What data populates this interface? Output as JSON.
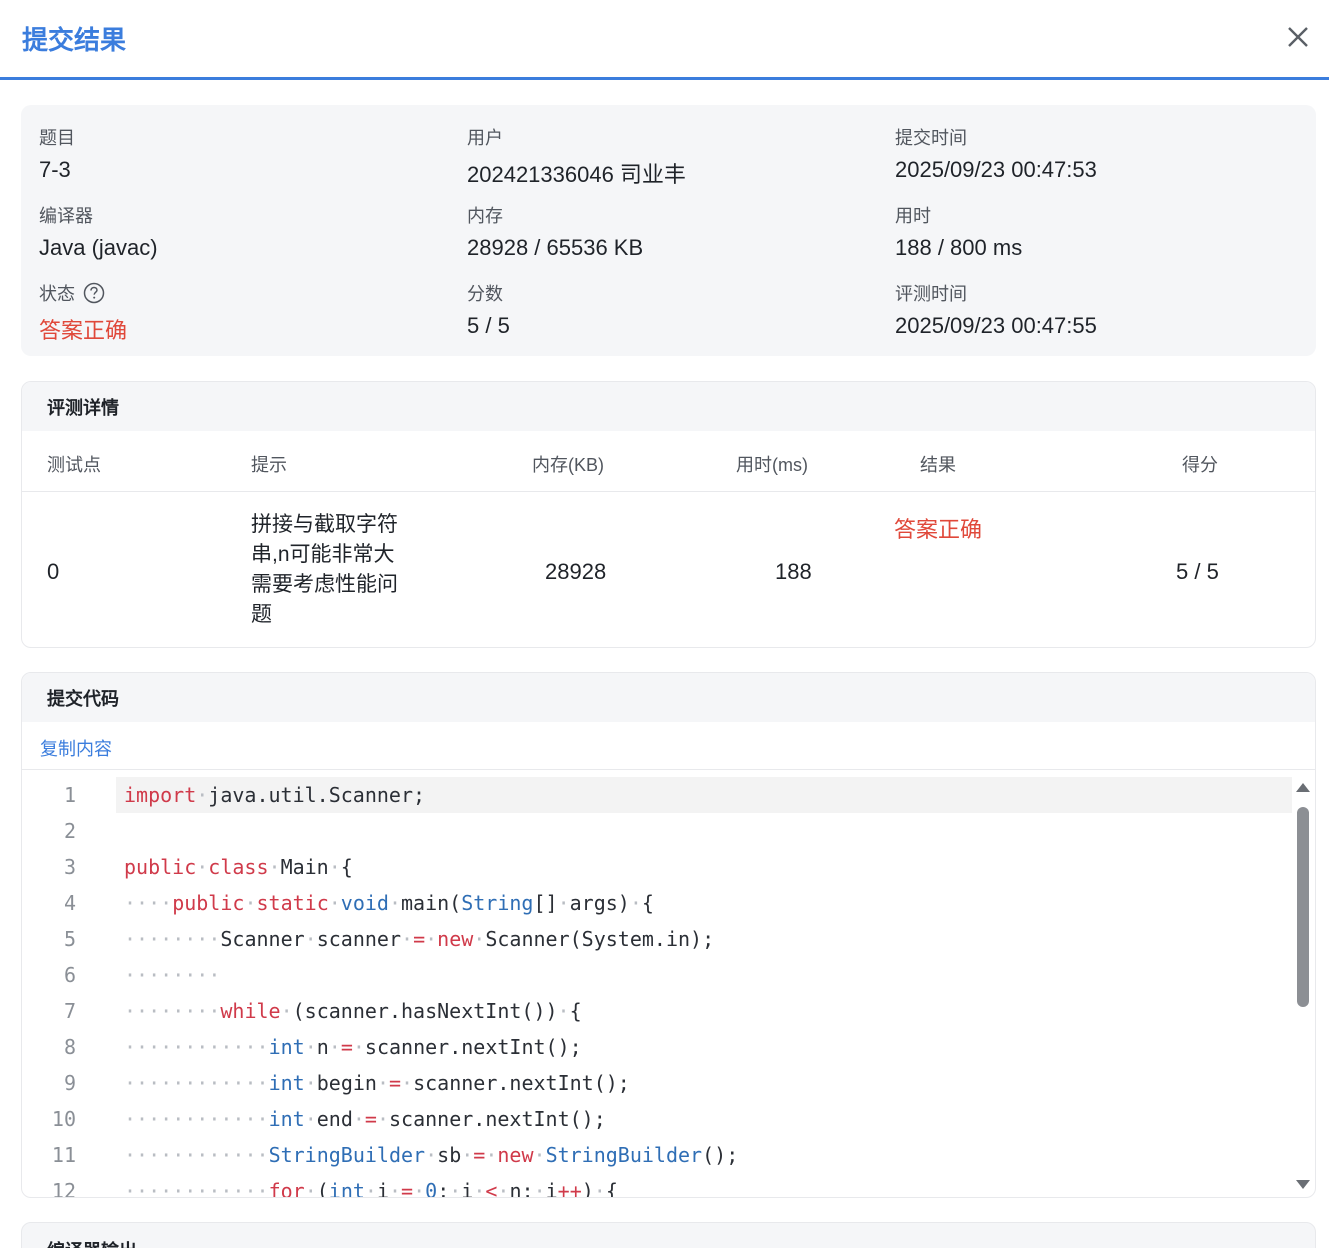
{
  "dialog": {
    "title": "提交结果"
  },
  "info": {
    "problem": {
      "label": "题目",
      "value": "7-3"
    },
    "user": {
      "label": "用户",
      "value": "202421336046 司业丰"
    },
    "submit_time": {
      "label": "提交时间",
      "value": "2025/09/23 00:47:53"
    },
    "compiler": {
      "label": "编译器",
      "value": "Java (javac)"
    },
    "memory": {
      "label": "内存",
      "value": "28928 / 65536 KB"
    },
    "time_used": {
      "label": "用时",
      "value": "188 / 800 ms"
    },
    "status": {
      "label": "状态",
      "value": "答案正确"
    },
    "score": {
      "label": "分数",
      "value": "5 / 5"
    },
    "judge_time": {
      "label": "评测时间",
      "value": "2025/09/23 00:47:55"
    }
  },
  "judge": {
    "title": "评测详情",
    "columns": [
      "测试点",
      "提示",
      "内存(KB)",
      "用时(ms)",
      "结果",
      "得分"
    ],
    "rows": [
      {
        "case": "0",
        "hint": "拼接与截取字符串,n可能非常大需要考虑性能问题",
        "memory": "28928",
        "time": "188",
        "result": "答案正确",
        "score": "5 / 5"
      }
    ]
  },
  "code_panel": {
    "title": "提交代码",
    "copy_label": "复制内容",
    "line_numbers": [
      "1",
      "2",
      "3",
      "4",
      "5",
      "6",
      "7",
      "8",
      "9",
      "10",
      "11",
      "12"
    ],
    "lines": [
      "import java.util.Scanner;",
      "",
      "public class Main {",
      "    public static void main(String[] args) {",
      "        Scanner scanner = new Scanner(System.in);",
      "        ",
      "        while (scanner.hasNextInt()) {",
      "            int n = scanner.nextInt();",
      "            int begin = scanner.nextInt();",
      "            int end = scanner.nextInt();",
      "            StringBuilder sb = new StringBuilder();",
      "            for (int i = 0; i < n; i++) {"
    ]
  },
  "compiler_output": {
    "title": "编译器输出"
  },
  "colors": {
    "accent": "#3b7ddd",
    "accepted": "#e0483a",
    "keyword": "#d03a4a",
    "type": "#2f6eb5"
  },
  "icons": {
    "close": "close-icon",
    "help": "question-circle-icon"
  }
}
